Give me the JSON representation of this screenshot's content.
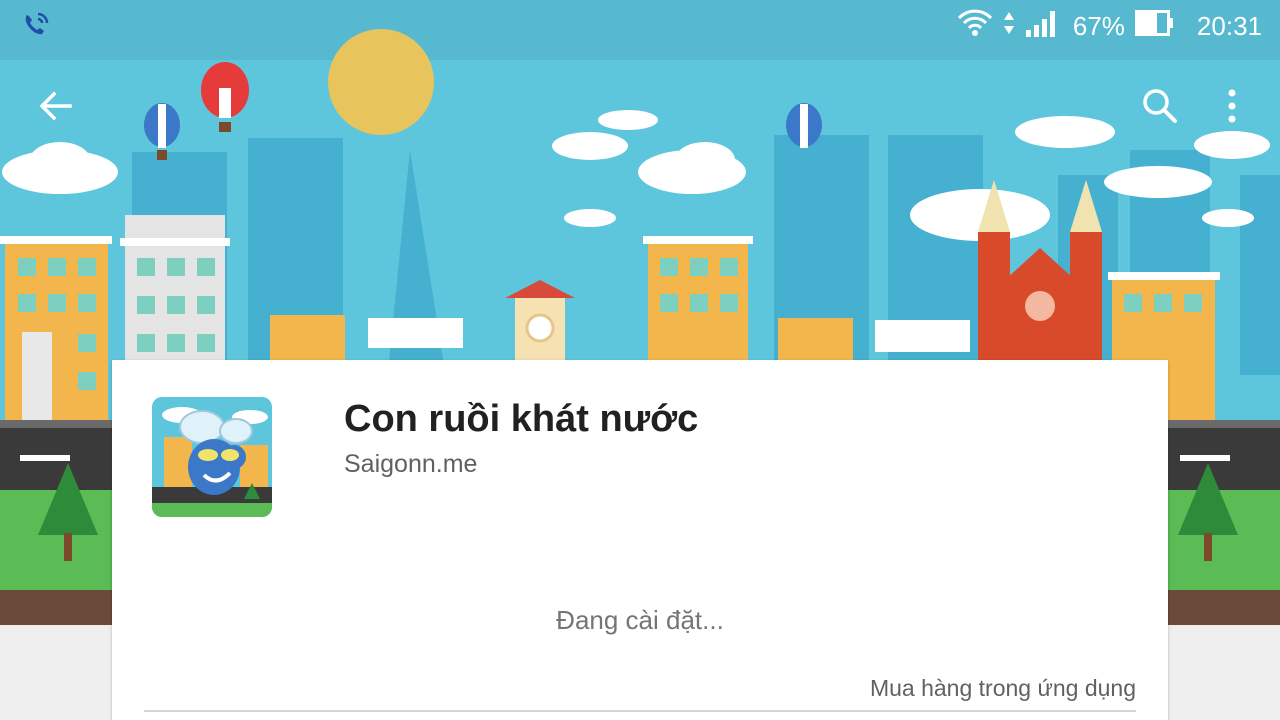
{
  "status_bar": {
    "left_icon": "phone-wifi-call-icon",
    "wifi_icon": "wifi-icon",
    "signal_icon": "cell-signal-icon",
    "battery_percent": "67%",
    "battery_level": 0.67,
    "battery_icon": "battery-icon",
    "time": "20:31"
  },
  "app_bar": {
    "back_icon": "arrow-back-icon",
    "search_icon": "search-icon",
    "more_icon": "more-vert-icon"
  },
  "app": {
    "title": "Con ruồi khát nước",
    "developer": "Saigonn.me",
    "install_status": "Đang cài đặt...",
    "in_app_purchases": "Mua hàng trong ứng dụng"
  },
  "colors": {
    "sky": "#5ec6dc",
    "sun": "#e8c45c",
    "card": "#ffffff",
    "title_text": "#212121"
  }
}
